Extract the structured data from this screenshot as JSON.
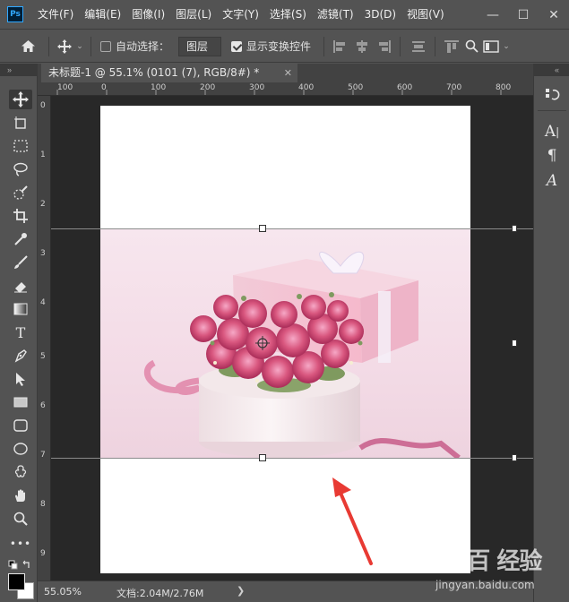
{
  "app": {
    "logo": "Ps"
  },
  "menubar": {
    "items": [
      "文件(F)",
      "编辑(E)",
      "图像(I)",
      "图层(L)",
      "文字(Y)",
      "选择(S)",
      "滤镜(T)",
      "3D(D)",
      "视图(V)"
    ],
    "window_controls": {
      "minimize": "—",
      "maximize": "☐",
      "close": "✕"
    }
  },
  "optionsbar": {
    "home_icon": "home-icon",
    "move_icon": "move-tool-icon",
    "auto_select_label": "自动选择：",
    "auto_select_checked": false,
    "auto_select_target": "图层",
    "show_transform_label": "显示变换控件",
    "show_transform_checked": true
  },
  "panels": {
    "collapse_left": "»",
    "collapse_right": "«"
  },
  "document": {
    "tab_title": "未标题-1 @ 55.1% (0101 (7), RGB/8#) *",
    "tab_close": "✕"
  },
  "rulers": {
    "horizontal": [
      "100",
      "0",
      "100",
      "200",
      "300",
      "400",
      "500",
      "600",
      "700",
      "800"
    ],
    "vertical": [
      "0",
      "1",
      "2",
      "3",
      "4",
      "5",
      "6",
      "7",
      "8",
      "9"
    ]
  },
  "tools": [
    "move-tool",
    "artboard-tool",
    "marquee-tool",
    "lasso-tool",
    "quick-select-tool",
    "crop-tool",
    "eyedropper-tool",
    "brush-tool",
    "eraser-tool",
    "gradient-tool",
    "type-tool",
    "pen-tool",
    "path-select-tool",
    "rectangle-tool",
    "rounded-rect-tool",
    "ellipse-tool",
    "custom-shape-tool",
    "hand-tool",
    "zoom-tool",
    "more-tools"
  ],
  "colors": {
    "foreground": "#000000",
    "background": "#ffffff",
    "annotation_arrow": "#e83a33"
  },
  "statusbar": {
    "zoom": "55.05%",
    "doc_info": "文档:2.04M/2.76M",
    "arrow": "❯"
  },
  "right_panel": [
    "history-icon",
    "character-icon",
    "paragraph-icon",
    "glyphs-icon"
  ],
  "watermark": {
    "brand": "Bai百 经验",
    "url": "jingyan.baidu.com"
  }
}
